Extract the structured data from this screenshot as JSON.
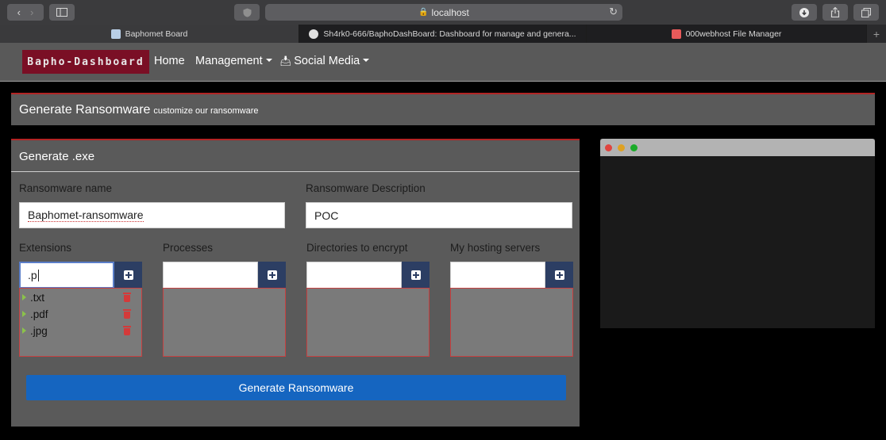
{
  "browser": {
    "address": "localhost",
    "tabs": [
      {
        "label": "Baphomet Board",
        "favicon_color": "#b9cfe8"
      },
      {
        "label": "Sh4rk0-666/BaphoDashBoard: Dashboard for manage and genera...",
        "favicon_color": "#e0e0e0"
      },
      {
        "label": "000webhost File Manager",
        "favicon_color": "#e85a5a"
      }
    ],
    "new_tab": "+"
  },
  "navbar": {
    "brand": "Bapho-Dashboard",
    "home": "Home",
    "management": "Management",
    "social_media": "Social Media"
  },
  "header": {
    "title": "Generate Ransomware",
    "subtitle": "customize our ransomware"
  },
  "form": {
    "title": "Generate .exe",
    "name_label": "Ransomware name",
    "name_value": "Baphomet-ransomware",
    "description_label": "Ransomware Description",
    "description_value": "POC",
    "extensions": {
      "label": "Extensions",
      "input_value": ".p",
      "items": [
        ".txt",
        ".pdf",
        ".jpg"
      ]
    },
    "processes": {
      "label": "Processes",
      "input_value": ""
    },
    "directories": {
      "label": "Directories to encrypt",
      "input_value": ""
    },
    "servers": {
      "label": "My hosting servers",
      "input_value": ""
    },
    "submit_label": "Generate Ransomware"
  },
  "colors": {
    "accent_red": "#b32424",
    "button_blue": "#1565c0",
    "brand_bg": "#7a0f25",
    "add_button": "#2c3e63",
    "traffic_red": "#e0443e",
    "traffic_yellow": "#dea123",
    "traffic_green": "#1aab29"
  }
}
